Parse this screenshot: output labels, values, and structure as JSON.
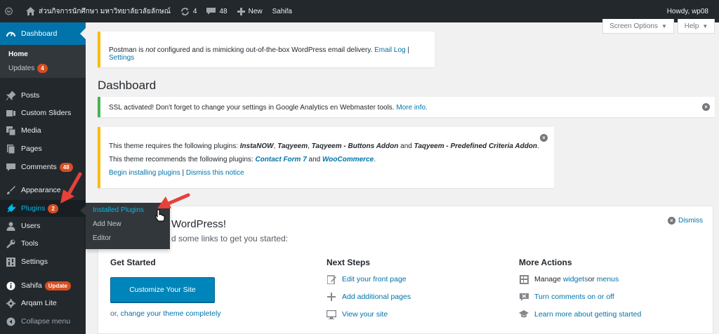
{
  "adminbar": {
    "site_name": "ส่วนกิจการนักศึกษา มหาวิทยาลัยวลัยลักษณ์",
    "updates_count": "4",
    "comments_count": "48",
    "new_label": "New",
    "sahifa_label": "Sahifa",
    "howdy": "Howdy, wp08"
  },
  "sidebar": {
    "dashboard": "Dashboard",
    "home": "Home",
    "updates": "Updates",
    "updates_badge": "4",
    "posts": "Posts",
    "custom_sliders": "Custom Sliders",
    "media": "Media",
    "pages": "Pages",
    "comments": "Comments",
    "comments_badge": "48",
    "appearance": "Appearance",
    "plugins": "Plugins",
    "plugins_badge": "2",
    "users": "Users",
    "tools": "Tools",
    "settings": "Settings",
    "sahifa": "Sahifa",
    "sahifa_badge": "Update",
    "arqam": "Arqam Lite",
    "collapse": "Collapse menu"
  },
  "flyout": {
    "installed": "Installed Plugins",
    "add_new": "Add New",
    "editor": "Editor"
  },
  "screen_meta": {
    "screen_options": "Screen Options",
    "help": "Help"
  },
  "postman_notice": {
    "part1": "Postman is ",
    "emph": "not",
    "part2": " configured and is mimicking out-of-the-box WordPress email delivery. ",
    "link1": "Email Log",
    "sep": " | ",
    "link2": "Settings"
  },
  "page_title": "Dashboard",
  "ssl_notice": {
    "text": "SSL activated!  Don't forget to change your settings in Google Analytics en Webmaster tools. ",
    "link": "More info."
  },
  "theme_notice": {
    "line1_prefix": "This theme requires the following plugins: ",
    "req1": "InstaNOW",
    "req2": "Taqyeem",
    "req3": "Taqyeem - Buttons Addon",
    "and": " and ",
    "req4": "Taqyeem - Predefined Criteria Addon",
    "comma": ", ",
    "period": ".",
    "line2_prefix": "This theme recommends the following plugins: ",
    "rec1": "Contact Form 7",
    "rec2": "WooCommerce",
    "begin": "Begin installing plugins",
    "sep": " | ",
    "dismiss": "Dismiss this notice"
  },
  "welcome": {
    "title": "WordPress!",
    "subtitle": "d some links to get you started:",
    "dismiss": "Dismiss",
    "get_started": "Get Started",
    "customize": "Customize Your Site",
    "or_prefix": "or, ",
    "change_theme": "change your theme completely",
    "next_steps": "Next Steps",
    "edit_front": "Edit your front page",
    "add_pages": "Add additional pages",
    "view_site": "View your site",
    "more_actions": "More Actions",
    "manage": "Manage ",
    "widgets": "widgets",
    "or": " or ",
    "menus": "menus",
    "turn_comments": "Turn comments on or off",
    "learn_more": "Learn more about getting started"
  },
  "colors": {
    "adminbar": "#23282d",
    "active": "#0073aa",
    "badge": "#d54e21",
    "warning": "#ffba00",
    "success": "#46b450",
    "annotation": "#e8403a"
  }
}
